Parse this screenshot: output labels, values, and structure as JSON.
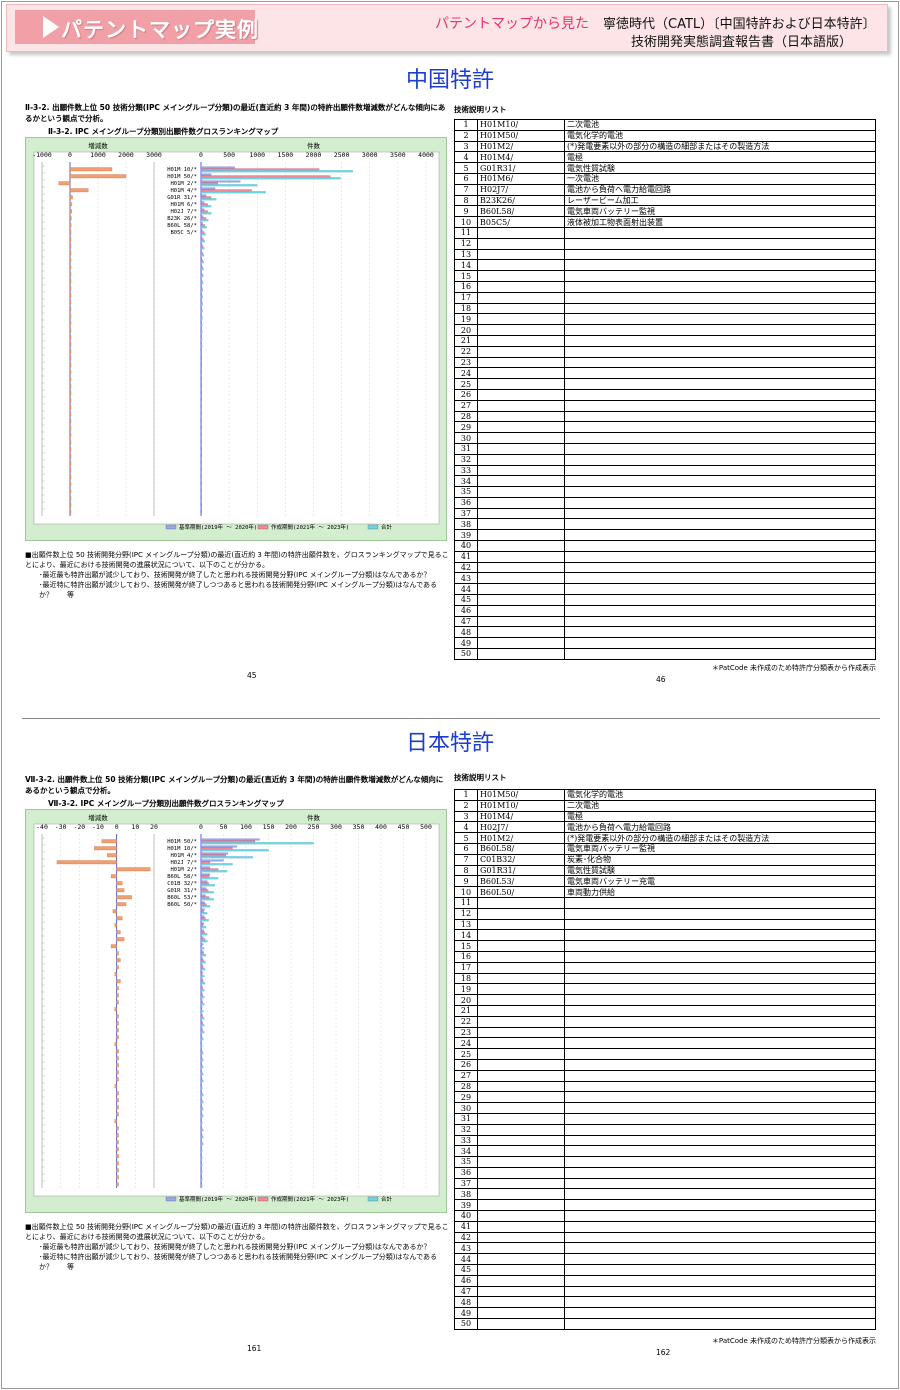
{
  "header": {
    "badge": "パテントマップ実例",
    "subtitle": "パテントマップから見た",
    "title_line1": "寧徳時代（CATL）〔中国特許および日本特許〕",
    "title_line2": "技術開発実態調査報告書（日本語版）"
  },
  "colors": {
    "accent": "#e8336b",
    "title_blue": "#1d3dcc",
    "header_bg": "#fde5e7",
    "badge_bg": "#f2a0a8",
    "chart_bg": "#d3edcf",
    "bar_base": "#9aa6e8",
    "bar_recent": "#f08898",
    "bar_total": "#6fd3e8",
    "diff_bar": "#f0a070"
  },
  "sections": [
    {
      "title": "中国特許",
      "question": "Ⅱ-3-2. 出願件数上位 50 技術分類(IPC メイングループ分類)の最近(直近約 3 年間)の特許出願件数増減数がどんな傾向にあるかという観点で分析。",
      "chart_title": "Ⅱ-3-2. IPC メイングループ分類別出願件数グロスランキングマップ",
      "note_main": "■出願件数上位 50 技術開発分野(IPC メイングループ分類)の最近(直近約 3 年間)の特許出願件数を、グロスランキングマップで見ることにより、最近における技術開発の進展状況について、以下のことが分かる。",
      "note_item1": "･最近最も特許出願が減少しており、技術開発が終了したと思われる技術開発分野(IPC メイングループ分類)はなんであるか？",
      "note_item2": "･最近特に特許出願が減少しており、技術開発が終了しつつあると思われる技術開発分野(IPC メイングループ分類)はなんであるか？　　等",
      "page_left": "45",
      "page_right": "46",
      "legend_title": "技術説明リスト",
      "footnote": "＊PatCode 未作成のため特許庁分類表から作成表示",
      "legend_items": [
        {
          "n": "1",
          "code": "H01M10/",
          "desc": "二次電池"
        },
        {
          "n": "2",
          "code": "H01M50/",
          "desc": "電気化学的電池"
        },
        {
          "n": "3",
          "code": "H01M2/",
          "desc": "(*)発電要素以外の部分の構造の細部またはその製造方法"
        },
        {
          "n": "4",
          "code": "H01M4/",
          "desc": "電極"
        },
        {
          "n": "5",
          "code": "G01R31/",
          "desc": "電気性質試験"
        },
        {
          "n": "6",
          "code": "H01M6/",
          "desc": "一次電池"
        },
        {
          "n": "7",
          "code": "H02J7/",
          "desc": "電池から負荷へ電力給電回路"
        },
        {
          "n": "8",
          "code": "B23K26/",
          "desc": "レーザービーム加工"
        },
        {
          "n": "9",
          "code": "B60L58/",
          "desc": "電気車両バッテリー監視"
        },
        {
          "n": "10",
          "code": "B05C5/",
          "desc": "液体被加工物表面射出装置"
        }
      ],
      "chart_data": {
        "type": "bar",
        "title": "Ⅱ-3-2. IPC メイングループ分類別出願件数グロスランキングマップ",
        "diff_panel": {
          "xlabel": "増減数",
          "xlim": [
            -1000,
            3000
          ],
          "ticks": [
            "-1000",
            "0",
            "1000",
            "2000",
            "3000"
          ]
        },
        "count_panel": {
          "xlabel": "件数",
          "xlim": [
            0,
            4000
          ],
          "ticks": [
            "0",
            "500",
            "1000",
            "1500",
            "2000",
            "2500",
            "3000",
            "3500",
            "4000"
          ]
        },
        "categories": [
          "H01M 10/*",
          "H01M 50/*",
          "H01M 2/*",
          "H01M 4/*",
          "G01R 31/*",
          "H01M 6/*",
          "H02J 7/*",
          "B23K 26/*",
          "B60L 58/*",
          "B05C 5/*"
        ],
        "legend": [
          "基準期間(2019年 ～ 2020年)",
          "作成期間(2021年 ～ 2023年)",
          "合計"
        ],
        "diff_values": [
          1500,
          2000,
          -400,
          650,
          90,
          60,
          60,
          50,
          40,
          30,
          25,
          20,
          20,
          18,
          15,
          15,
          12,
          12,
          10,
          10,
          10,
          8,
          8,
          8,
          6,
          6,
          5,
          5,
          5,
          4,
          4,
          4,
          3,
          3,
          3,
          2,
          2,
          2,
          2,
          2,
          1,
          1,
          1,
          1,
          1,
          1,
          1,
          1,
          1,
          1
        ],
        "series": [
          {
            "name": "基準期間(2019年 ～ 2020年)",
            "values": [
              600,
              180,
              700,
              250,
              90,
              60,
              60,
              40,
              30,
              25,
              20,
              18,
              16,
              15,
              14,
              13,
              12,
              11,
              10,
              10,
              9,
              9,
              8,
              8,
              7,
              7,
              6,
              6,
              6,
              5,
              5,
              5,
              5,
              4,
              4,
              4,
              4,
              3,
              3,
              3,
              3,
              3,
              2,
              2,
              2,
              2,
              2,
              2,
              2,
              2
            ]
          },
          {
            "name": "作成期間(2021年 ～ 2023年)",
            "values": [
              2100,
              2300,
              300,
              900,
              180,
              120,
              120,
              90,
              70,
              55,
              45,
              38,
              36,
              33,
              30,
              28,
              25,
              23,
              20,
              20,
              19,
              17,
              16,
              16,
              13,
              13,
              11,
              11,
              11,
              9,
              9,
              9,
              8,
              7,
              7,
              6,
              6,
              5,
              5,
              5,
              4,
              4,
              3,
              3,
              3,
              3,
              3,
              3,
              3,
              3
            ]
          },
          {
            "name": "合計",
            "values": [
              2700,
              2480,
              1000,
              1150,
              270,
              180,
              180,
              130,
              100,
              80,
              65,
              56,
              52,
              48,
              44,
              41,
              37,
              34,
              30,
              30,
              28,
              26,
              24,
              24,
              20,
              20,
              17,
              17,
              17,
              14,
              14,
              14,
              13,
              11,
              11,
              10,
              10,
              8,
              8,
              8,
              7,
              7,
              5,
              5,
              5,
              5,
              5,
              5,
              5,
              5
            ]
          }
        ]
      }
    },
    {
      "title": "日本特許",
      "question": "Ⅶ-3-2. 出願件数上位 50 技術分類(IPC メイングループ分類)の最近(直近約 3 年間)の特許出願件数増減数がどんな傾向にあるかという観点で分析。",
      "chart_title": "Ⅶ-3-2. IPC メイングループ分類別出願件数グロスランキングマップ",
      "note_main": "■出願件数上位 50 技術開発分野(IPC メイングループ分類)の最近(直近約 3 年間)の特許出願件数を、グロスランキングマップで見ることにより、最近における技術開発の進展状況について、以下のことが分かる。",
      "note_item1": "･最近最も特許出願が減少しており、技術開発が終了したと思われる技術開発分野(IPC メイングループ分類)はなんであるか？",
      "note_item2": "･最近特に特許出願が減少しており、技術開発が終了しつつあると思われる技術開発分野(IPC メイングループ分類)はなんであるか？　　等",
      "page_left": "161",
      "page_right": "162",
      "legend_title": "技術説明リスト",
      "footnote": "＊PatCode 未作成のため特許庁分類表から作成表示",
      "legend_items": [
        {
          "n": "1",
          "code": "H01M50/",
          "desc": "電気化学的電池"
        },
        {
          "n": "2",
          "code": "H01M10/",
          "desc": "二次電池"
        },
        {
          "n": "3",
          "code": "H01M4/",
          "desc": "電極"
        },
        {
          "n": "4",
          "code": "H02J7/",
          "desc": "電池から負荷へ電力給電回路"
        },
        {
          "n": "5",
          "code": "H01M2/",
          "desc": "(*)発電要素以外の部分の構造の細部またはその製造方法"
        },
        {
          "n": "6",
          "code": "B60L58/",
          "desc": "電気車両バッテリー監視"
        },
        {
          "n": "7",
          "code": "C01B32/",
          "desc": "炭素･化合物"
        },
        {
          "n": "8",
          "code": "G01R31/",
          "desc": "電気性質試験"
        },
        {
          "n": "9",
          "code": "B60L53/",
          "desc": "電気車両バッテリー充電"
        },
        {
          "n": "10",
          "code": "B60L50/",
          "desc": "車両動力供給"
        }
      ],
      "chart_data": {
        "type": "bar",
        "title": "Ⅶ-3-2. IPC メイングループ分類別出願件数グロスランキングマップ",
        "diff_panel": {
          "xlabel": "増減数",
          "xlim": [
            -40,
            20
          ],
          "ticks": [
            "-40",
            "-30",
            "-20",
            "-10",
            "0",
            "10",
            "20"
          ]
        },
        "count_panel": {
          "xlabel": "件数",
          "xlim": [
            0,
            500
          ],
          "ticks": [
            "0",
            "50",
            "100",
            "150",
            "200",
            "250",
            "300",
            "350",
            "400",
            "450",
            "500"
          ]
        },
        "categories": [
          "H01M 50/*",
          "H01M 10/*",
          "H01M 4/*",
          "H02J 7/*",
          "H01M 2/*",
          "B60L 58/*",
          "C01B 32/*",
          "G01R 31/*",
          "B60L 53/*",
          "B60L 50/*"
        ],
        "legend": [
          "基準期間(2019年 ～ 2020年)",
          "作成期間(2021年 ～ 2023年)",
          "合計"
        ],
        "diff_values": [
          -8,
          -12,
          -5,
          -32,
          18,
          -3,
          3,
          4,
          8,
          5,
          -2,
          3,
          -1,
          2,
          4,
          -3,
          1,
          2,
          1,
          -1,
          2,
          1,
          1,
          1,
          -1,
          1,
          1,
          1,
          1,
          -1,
          1,
          1,
          1,
          1,
          1,
          -1,
          1,
          1,
          1,
          1,
          -1,
          1,
          1,
          1,
          1,
          1,
          1,
          1,
          1,
          1
        ],
        "series": [
          {
            "name": "基準期間(2019年 ～ 2020年)",
            "values": [
              130,
              80,
              60,
              50,
              20,
              20,
              14,
              12,
              10,
              8,
              8,
              7,
              6,
              6,
              5,
              5,
              5,
              4,
              4,
              4,
              4,
              3,
              3,
              3,
              3,
              3,
              3,
              3,
              2,
              2,
              2,
              2,
              2,
              2,
              2,
              2,
              2,
              2,
              2,
              2,
              2,
              2,
              2,
              2,
              1,
              1,
              1,
              1,
              1,
              1
            ]
          },
          {
            "name": "作成期間(2021年 ～ 2023年)",
            "values": [
              120,
              70,
              55,
              20,
              38,
              18,
              17,
              16,
              18,
              12,
              6,
              10,
              5,
              8,
              9,
              2,
              6,
              6,
              5,
              3,
              5,
              4,
              4,
              4,
              2,
              4,
              4,
              4,
              3,
              1,
              3,
              3,
              3,
              3,
              3,
              1,
              3,
              3,
              3,
              3,
              1,
              3,
              3,
              3,
              2,
              2,
              2,
              2,
              2,
              2
            ]
          },
          {
            "name": "合計",
            "values": [
              250,
              150,
              115,
              70,
              58,
              38,
              31,
              28,
              28,
              20,
              14,
              17,
              11,
              14,
              14,
              7,
              11,
              10,
              9,
              7,
              9,
              7,
              7,
              7,
              5,
              7,
              7,
              7,
              5,
              3,
              5,
              5,
              5,
              5,
              5,
              3,
              5,
              5,
              5,
              5,
              3,
              5,
              5,
              5,
              3,
              3,
              3,
              3,
              3,
              3
            ]
          }
        ]
      }
    }
  ]
}
